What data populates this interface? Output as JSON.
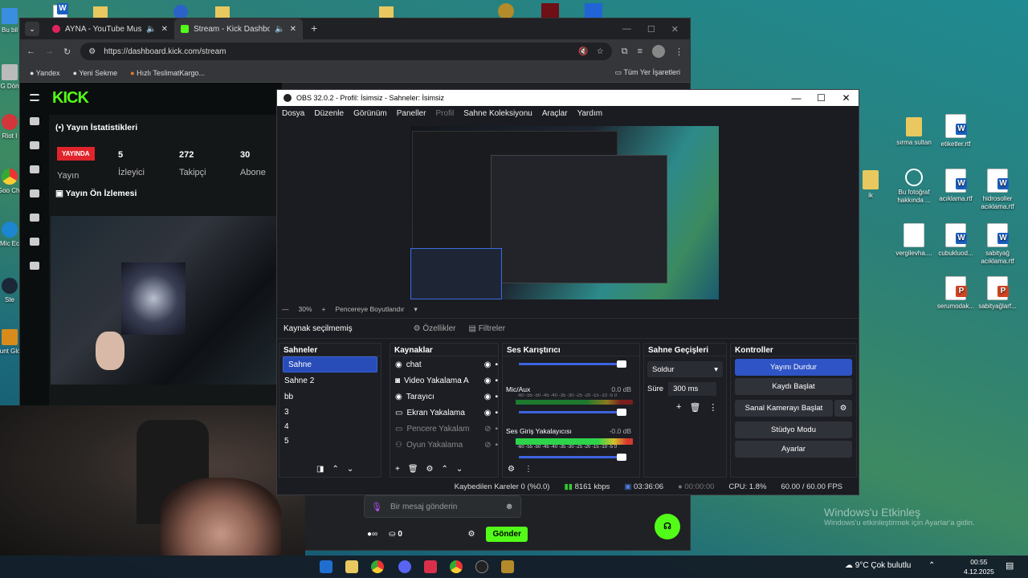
{
  "desktop_left": [
    {
      "label": "Bu bil"
    },
    {
      "label": "G Dön"
    },
    {
      "label": "Riot I"
    },
    {
      "label": "Goo Chr"
    },
    {
      "label": "Mic Ec"
    },
    {
      "label": "Ste"
    },
    {
      "label": "Count Globa"
    }
  ],
  "desktop_right": [
    {
      "label": "sırma sultan",
      "type": "folder"
    },
    {
      "label": "etiketler.rtf",
      "type": "doc"
    },
    {
      "label": "Bu fotoğraf hakkında ...",
      "type": "info"
    },
    {
      "label": "acıklama.rtf",
      "type": "doc"
    },
    {
      "label": "hidrosoller acıklama.rtf",
      "type": "doc"
    },
    {
      "label": "vergilevha....",
      "type": "image"
    },
    {
      "label": "cubukluod...",
      "type": "doc"
    },
    {
      "label": "sabityağ acıklama.rtf",
      "type": "doc"
    },
    {
      "label": "serumodak...",
      "type": "ppt"
    },
    {
      "label": "sabityağlarf...",
      "type": "ppt"
    },
    {
      "label": "ik",
      "type": "folder"
    }
  ],
  "browser": {
    "tabs": [
      {
        "title": "AYNA - YouTube Music"
      },
      {
        "title": "Stream - Kick Dashboard"
      }
    ],
    "url": "https://dashboard.kick.com/stream",
    "bookmarks": [
      "Yandex",
      "Yeni Sekme",
      "Hızlı TeslimatKargo...",
      "Tüm Yer İşaretleri"
    ]
  },
  "kick": {
    "logo": "KICK",
    "stats_title": "Yayın İstatistikleri",
    "live_badge": "YAYINDA",
    "stat1_label": "Yayın",
    "viewers": "5",
    "viewers_label": "İzleyici",
    "followers": "272",
    "followers_label": "Takipçi",
    "subs": "30",
    "subs_label": "Abone Sayısı",
    "preview_title": "Yayın Ön İzlemesi",
    "chat_placeholder": "Bir mesaj gönderin",
    "chat_count": "0",
    "send": "Gönder"
  },
  "obs": {
    "title": "OBS 32.0.2 - Profil: İsimsiz - Sahneler: İsimsiz",
    "menu": [
      "Dosya",
      "Düzenle",
      "Görünüm",
      "Paneller",
      "Profil",
      "Sahne Koleksiyonu",
      "Araçlar",
      "Yardım"
    ],
    "zoom": "30%",
    "fit": "Pencereye Boyutlandır",
    "no_source": "Kaynak seçilmemiş",
    "properties": "Özellikler",
    "filters": "Filtreler",
    "scenes_title": "Sahneler",
    "scenes": [
      "Sahne",
      "Sahne 2",
      "bb",
      "3",
      "4",
      "5"
    ],
    "sources_title": "Kaynaklar",
    "sources": [
      {
        "name": "chat",
        "icon": "browser-icon"
      },
      {
        "name": "Video Yakalama A",
        "icon": "camera-icon"
      },
      {
        "name": "Tarayıcı",
        "icon": "browser-icon"
      },
      {
        "name": "Ekran Yakalama",
        "icon": "monitor-icon"
      },
      {
        "name": "Pencere Yakalam",
        "icon": "window-icon"
      },
      {
        "name": "Oyun Yakalama",
        "icon": "gamepad-icon"
      }
    ],
    "mixer_title": "Ses Karıştırıcı",
    "scale": "-60 -55 -50 -45 -40 -35 -30 -25 -20 -15 -10 -5 0",
    "mixer": [
      {
        "name": "",
        "db": ""
      },
      {
        "name": "Mic/Aux",
        "db": "0.0 dB"
      },
      {
        "name": "Ses Giriş Yakalayıcısı",
        "db": "-0.0 dB"
      }
    ],
    "transitions_title": "Sahne Geçişleri",
    "transition": "Soldur",
    "duration_label": "Süre",
    "duration": "300 ms",
    "controls_title": "Kontroller",
    "controls": [
      "Yayını Durdur",
      "Kaydı Başlat",
      "Sanal Kamerayı Başlat",
      "Stüdyo Modu",
      "Ayarlar"
    ],
    "status": {
      "dropped": "Kaybedilen Kareler 0 (%0.0)",
      "bitrate": "8161 kbps",
      "stream_time": "03:36:06",
      "rec_time": "00:00:00",
      "cpu": "CPU: 1.8%",
      "fps": "60.00 / 60.00 FPS"
    }
  },
  "watermark": {
    "line1": "Windows'u Etkinleş",
    "line2": "Windows'u etkinleştirmek için Ayarlar'a gidin."
  },
  "taskbar": {
    "weather": "9°C  Çok bulutlu",
    "time": "00:55",
    "date": "4.12.2025"
  },
  "colors": {
    "kick_green": "#53fc18",
    "obs_blue": "#2f54c6",
    "live_red": "#e0242b"
  }
}
